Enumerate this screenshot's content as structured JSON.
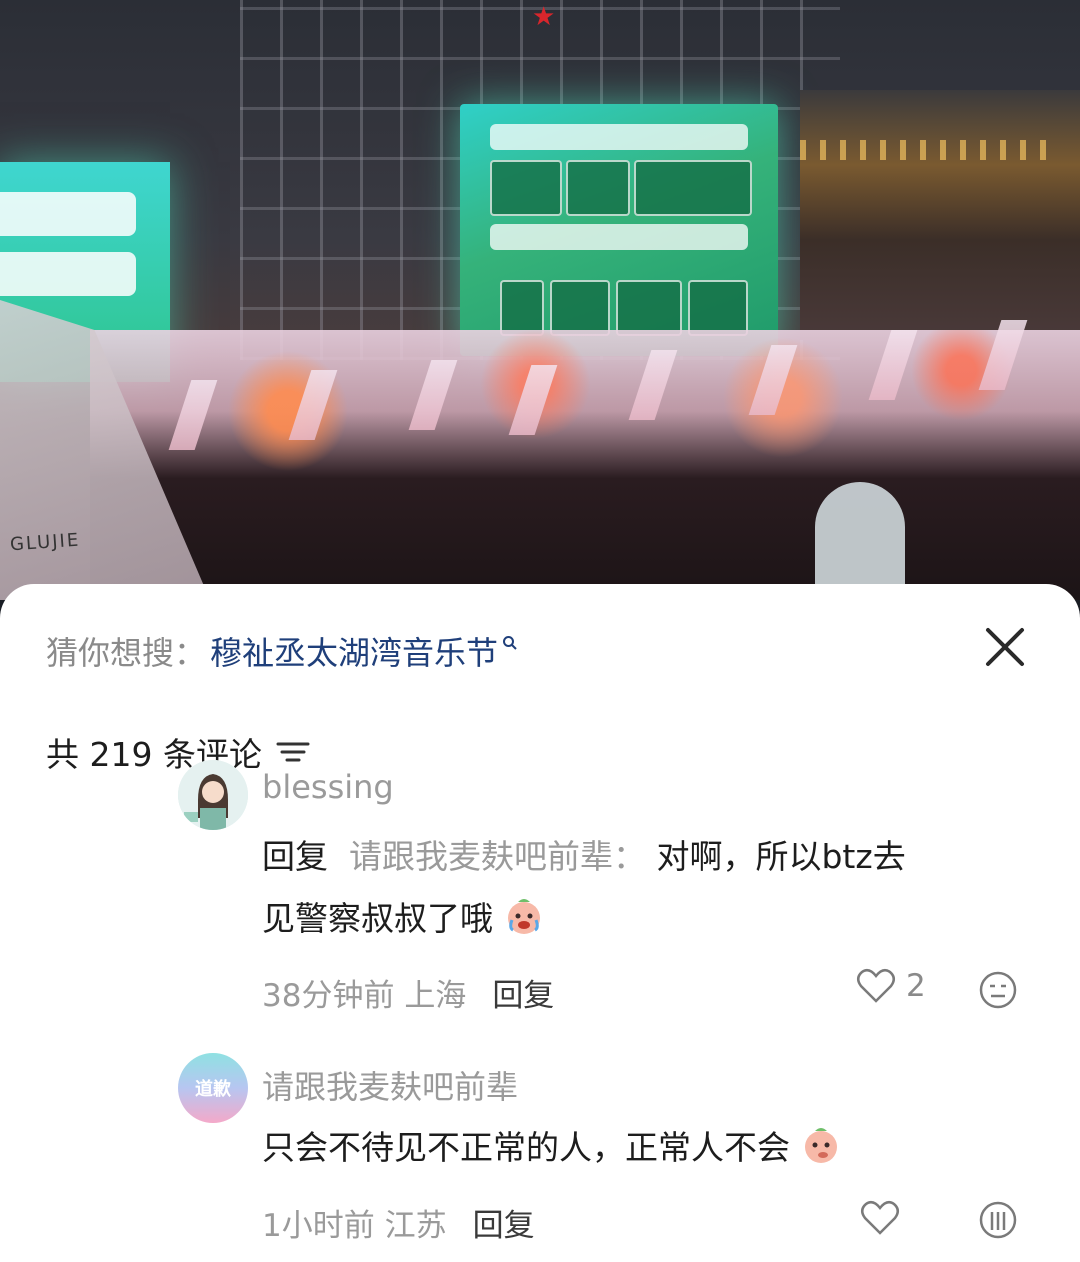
{
  "video": {
    "tent_text": "GLUJIE"
  },
  "suggestion": {
    "prefix": "猜你想搜：",
    "term": "穆祉丞太湖湾音乐节"
  },
  "comments_header": {
    "count_label": "共 219 条评论"
  },
  "comments": [
    {
      "username": "blessing",
      "reply_prefix": "回复",
      "reply_to": "请跟我麦麸吧前辈：",
      "text_line1": "对啊，所以btz去",
      "text_line2": "见警察叔叔了哦",
      "time": "38分钟前",
      "location": "上海",
      "reply_label": "回复",
      "likes": "2",
      "like_icon": "heart-icon",
      "dislike_icon": "neutral-face-icon"
    },
    {
      "username": "请跟我麦麸吧前辈",
      "avatar_text": "道歉",
      "text": "只会不待见不正常的人，正常人不会",
      "time": "1小时前",
      "location": "江苏",
      "reply_label": "回复",
      "like_icon": "heart-icon",
      "dislike_icon": "neutral-face-icon"
    }
  ],
  "colors": {
    "suggest_term": "#1f3f7a",
    "muted": "#9a9a9a",
    "text": "#1d1d1d"
  }
}
